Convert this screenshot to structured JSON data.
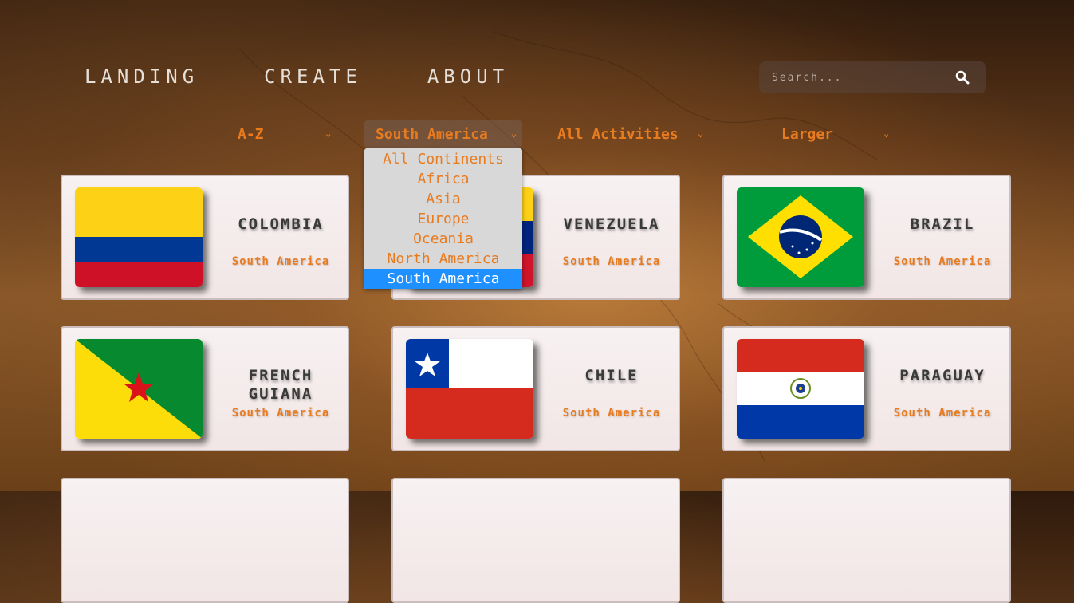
{
  "nav": {
    "landing": "LANDING",
    "create": "CREATE",
    "about": "ABOUT"
  },
  "search": {
    "placeholder": "Search..."
  },
  "filters": {
    "sort": "A-Z",
    "continent": "South America",
    "activities": "All Activities",
    "size": "Larger"
  },
  "continent_options": [
    "All Continents",
    "Africa",
    "Asia",
    "Europe",
    "Oceania",
    "North America",
    "South America"
  ],
  "continent_selected": "South America",
  "cards": [
    {
      "name": "COLOMBIA",
      "continent": "South America"
    },
    {
      "name": "VENEZUELA",
      "continent": "South America"
    },
    {
      "name": "BRAZIL",
      "continent": "South America"
    },
    {
      "name": "FRENCH GUIANA",
      "continent": "South America"
    },
    {
      "name": "CHILE",
      "continent": "South America"
    },
    {
      "name": "PARAGUAY",
      "continent": "South America"
    }
  ],
  "colors": {
    "accent": "#e97b1f",
    "selected": "#1e90ff",
    "card_bg": "#f4eaea"
  }
}
